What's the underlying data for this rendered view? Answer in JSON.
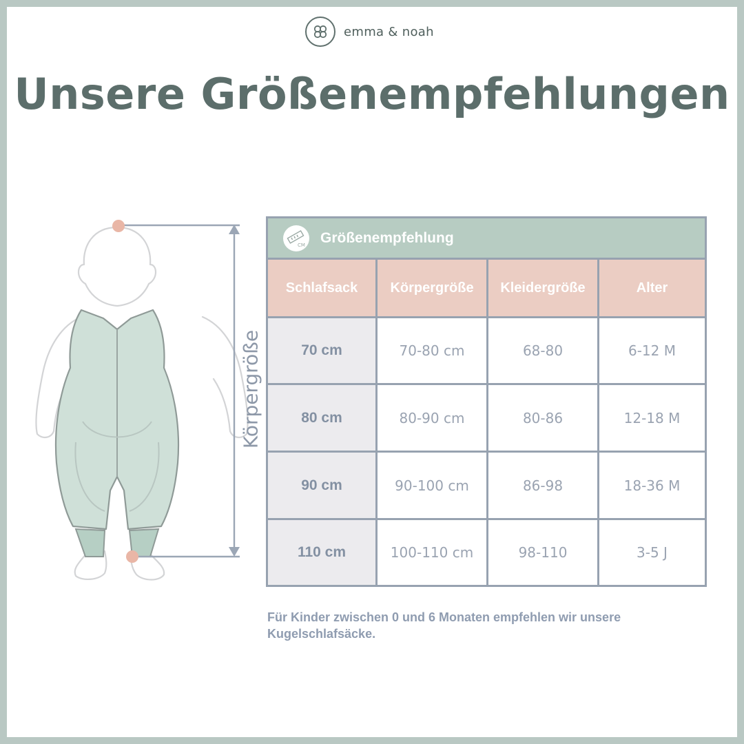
{
  "brand": {
    "name": "emma & noah",
    "logo_icon": "knot-logo-icon"
  },
  "title": "Unsere Größenempfehlungen",
  "figure": {
    "axis_label": "Körpergröße",
    "skin_dot_color": "#e9b6a6",
    "garment_color": "#cfe0d8"
  },
  "table": {
    "title": "Größenempfehlung",
    "title_icon": "ruler-cm-icon",
    "icon_text": "CM",
    "columns": [
      "Schlafsack",
      "Körpergröße",
      "Kleidergröße",
      "Alter"
    ],
    "rows": [
      [
        "70 cm",
        "70-80 cm",
        "68-80",
        "6-12 M"
      ],
      [
        "80 cm",
        "80-90 cm",
        "80-86",
        "12-18 M"
      ],
      [
        "90 cm",
        "90-100 cm",
        "86-98",
        "18-36 M"
      ],
      [
        "110 cm",
        "100-110 cm",
        "98-110",
        "3-5 J"
      ]
    ]
  },
  "note": "Für Kinder zwischen 0 und 6 Monaten empfehlen wir unsere Kugelschlafsäcke.",
  "colors": {
    "frame": "#b9c8c3",
    "title": "#5c6e6b",
    "header_band": "#b7ccc2",
    "column_header": "#ebcdc3",
    "first_column": "#ecebee",
    "grid": "#97a2b0",
    "text": "#8f9cb0"
  }
}
